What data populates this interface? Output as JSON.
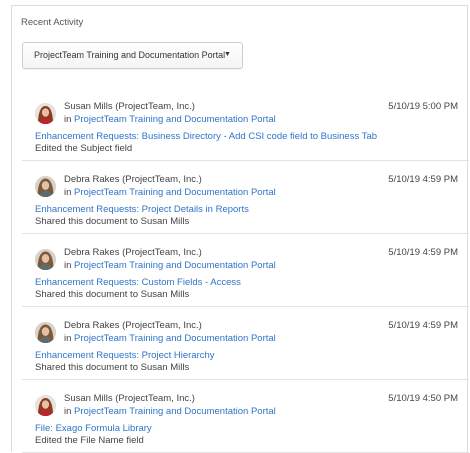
{
  "panel": {
    "title": "Recent Activity",
    "portal_select": {
      "selected": "ProjectTeam Training and Documentation Portal",
      "caret": "▼"
    }
  },
  "activities": [
    {
      "author": "Susan Mills (ProjectTeam, Inc.)",
      "in_prefix": "in",
      "portal": "ProjectTeam Training and Documentation Portal",
      "date": "5/10/19 5:00 PM",
      "document": "Enhancement Requests: Business Directory - Add CSI code field to Business Tab",
      "action": "Edited the Subject field",
      "avatar": "susan"
    },
    {
      "author": "Debra Rakes (ProjectTeam, Inc.)",
      "in_prefix": "in",
      "portal": "ProjectTeam Training and Documentation Portal",
      "date": "5/10/19 4:59 PM",
      "document": "Enhancement Requests: Project Details in Reports",
      "action": "Shared this document to Susan Mills",
      "avatar": "debra"
    },
    {
      "author": "Debra Rakes (ProjectTeam, Inc.)",
      "in_prefix": "in",
      "portal": "ProjectTeam Training and Documentation Portal",
      "date": "5/10/19 4:59 PM",
      "document": "Enhancement Requests: Custom Fields - Access",
      "action": "Shared this document to Susan Mills",
      "avatar": "debra"
    },
    {
      "author": "Debra Rakes (ProjectTeam, Inc.)",
      "in_prefix": "in",
      "portal": "ProjectTeam Training and Documentation Portal",
      "date": "5/10/19 4:59 PM",
      "document": "Enhancement Requests: Project Hierarchy",
      "action": "Shared this document to Susan Mills",
      "avatar": "debra"
    },
    {
      "author": "Susan Mills (ProjectTeam, Inc.)",
      "in_prefix": "in",
      "portal": "ProjectTeam Training and Documentation Portal",
      "date": "5/10/19 4:50 PM",
      "document": "File: Exago Formula Library",
      "action": "Edited the File Name field",
      "avatar": "susan"
    }
  ],
  "colors": {
    "link": "#2f74c8",
    "text": "#444444",
    "divider": "#e3e3e3"
  }
}
